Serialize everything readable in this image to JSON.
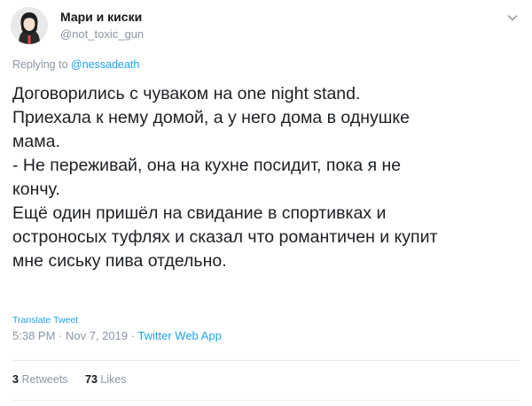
{
  "tweet": {
    "author": {
      "display_name": "Мари и киски",
      "handle": "@not_toxic_gun"
    },
    "reply": {
      "prefix": "Replying to",
      "mention": "@nessadeath"
    },
    "text_lines": [
      "Договорились с чуваком на one night stand.",
      "Приехала к нему домой, а у него дома в однушке",
      "мама.",
      "- Не переживай, она на кухне посидит, пока я не",
      "кончу.",
      "Ещё один пришёл на свидание в спортивках и",
      "остроносых туфлях и сказал что романтичен и купит",
      "мне сиську пива отдельно."
    ],
    "translate_label": "Translate Tweet",
    "timestamp": "5:38 PM · Nov 7, 2019 · ",
    "source_app": "Twitter Web App",
    "stats": {
      "retweets_count": "3",
      "retweets_label": "Retweets",
      "likes_count": "73",
      "likes_label": "Likes"
    }
  },
  "icons": {
    "caret": "chevron-down-icon",
    "avatar": "avatar-illustration"
  },
  "colors": {
    "link": "#1da1f2",
    "secondary_text": "#8a96a3",
    "primary_text": "#14171a",
    "divider": "#e6ecf0"
  }
}
